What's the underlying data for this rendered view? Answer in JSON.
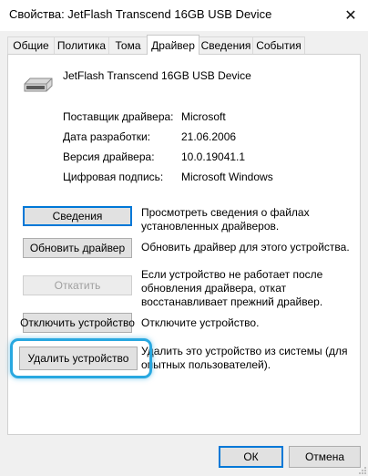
{
  "window": {
    "title": "Свойства: JetFlash Transcend 16GB USB Device",
    "close_icon": "close-icon"
  },
  "tabs": [
    {
      "label": "Общие",
      "active": false
    },
    {
      "label": "Политика",
      "active": false
    },
    {
      "label": "Тома",
      "active": false
    },
    {
      "label": "Драйвер",
      "active": true
    },
    {
      "label": "Сведения",
      "active": false
    },
    {
      "label": "События",
      "active": false
    }
  ],
  "device": {
    "icon": "usb-drive-icon",
    "name": "JetFlash Transcend 16GB USB Device"
  },
  "properties": [
    {
      "label": "Поставщик драйвера:",
      "value": "Microsoft"
    },
    {
      "label": "Дата разработки:",
      "value": "21.06.2006"
    },
    {
      "label": "Версия драйвера:",
      "value": "10.0.19041.1"
    },
    {
      "label": "Цифровая подпись:",
      "value": "Microsoft Windows"
    }
  ],
  "actions": [
    {
      "button": "Сведения",
      "description": "Просмотреть сведения о файлах установленных драйверов.",
      "enabled": true
    },
    {
      "button": "Обновить драйвер",
      "description": "Обновить драйвер для этого устройства.",
      "enabled": true
    },
    {
      "button": "Откатить",
      "description": "Если устройство не работает после обновления драйвера, откат восстанавливает прежний драйвер.",
      "enabled": false
    },
    {
      "button": "Отключить устройство",
      "description": "Отключите устройство.",
      "enabled": true
    },
    {
      "button": "Удалить устройство",
      "description": "Удалить это устройство из системы (для опытных пользователей).",
      "enabled": true,
      "highlighted": true
    }
  ],
  "footer": {
    "ok": "ОК",
    "cancel": "Отмена"
  },
  "colors": {
    "accent": "#0078d7",
    "highlight": "#29a8e0"
  }
}
